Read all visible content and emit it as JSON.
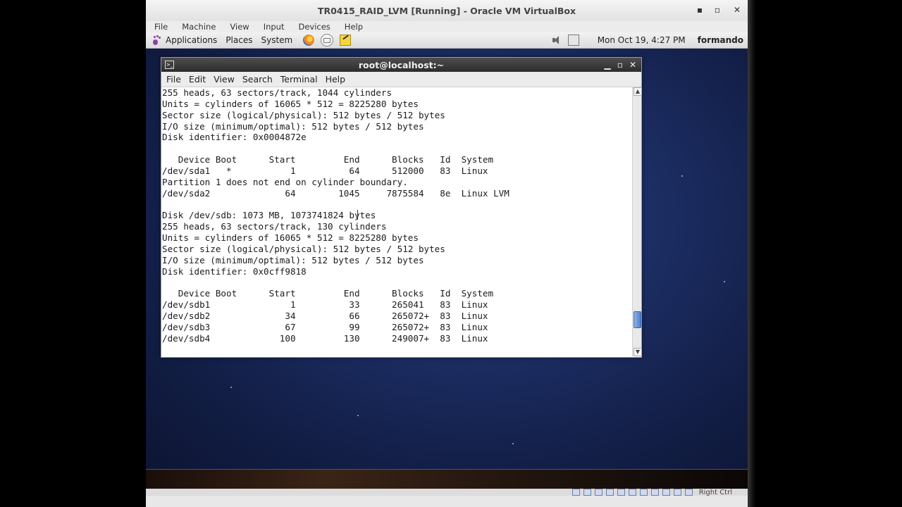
{
  "vbox": {
    "title": "TR0415_RAID_LVM [Running] - Oracle VM VirtualBox",
    "menu": [
      "File",
      "Machine",
      "View",
      "Input",
      "Devices",
      "Help"
    ],
    "controls": {
      "minimize": "▪",
      "maximize": "▫",
      "close": "✕"
    },
    "status": {
      "host_key": "Right Ctrl"
    }
  },
  "panel": {
    "applications": "Applications",
    "places": "Places",
    "system": "System",
    "datetime": "Mon Oct 19,  4:27 PM",
    "user": "formando"
  },
  "terminal": {
    "title": "root@localhost:~",
    "menu": [
      "File",
      "Edit",
      "View",
      "Search",
      "Terminal",
      "Help"
    ],
    "lines": [
      "255 heads, 63 sectors/track, 1044 cylinders",
      "Units = cylinders of 16065 * 512 = 8225280 bytes",
      "Sector size (logical/physical): 512 bytes / 512 bytes",
      "I/O size (minimum/optimal): 512 bytes / 512 bytes",
      "Disk identifier: 0x0004872e",
      "",
      "   Device Boot      Start         End      Blocks   Id  System",
      "/dev/sda1   *           1          64      512000   83  Linux",
      "Partition 1 does not end on cylinder boundary.",
      "/dev/sda2              64        1045     7875584   8e  Linux LVM",
      "",
      "Disk /dev/sdb: 1073 MB, 1073741824 bytes",
      "255 heads, 63 sectors/track, 130 cylinders",
      "Units = cylinders of 16065 * 512 = 8225280 bytes",
      "Sector size (logical/physical): 512 bytes / 512 bytes",
      "I/O size (minimum/optimal): 512 bytes / 512 bytes",
      "Disk identifier: 0x0cff9818",
      "",
      "   Device Boot      Start         End      Blocks   Id  System",
      "/dev/sdb1               1          33      265041   83  Linux",
      "/dev/sdb2              34          66      265072+  83  Linux",
      "/dev/sdb3              67          99      265072+  83  Linux",
      "/dev/sdb4             100         130      249007+  83  Linux"
    ]
  }
}
